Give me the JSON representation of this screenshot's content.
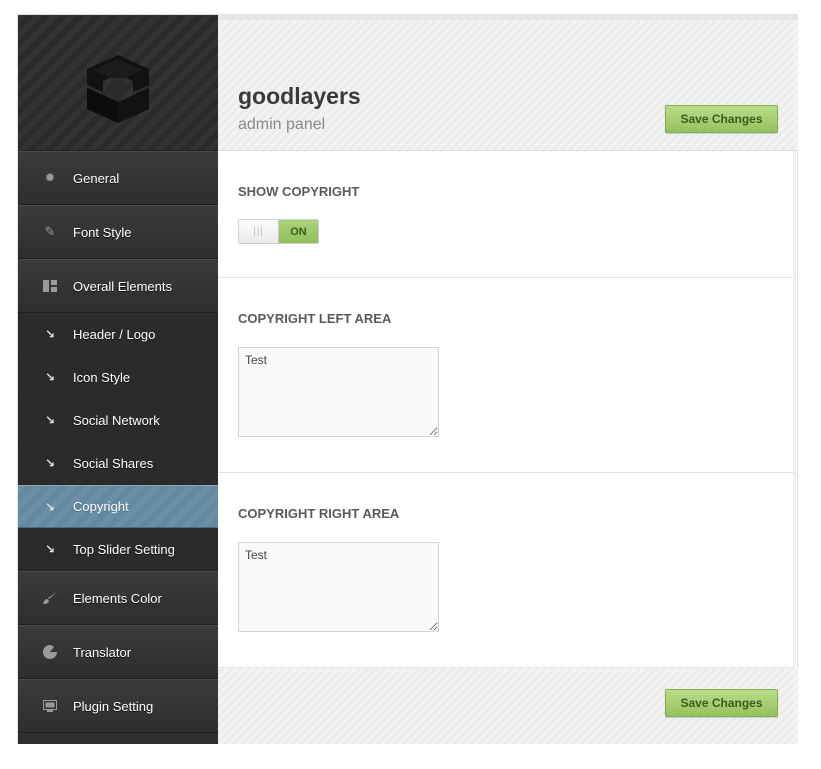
{
  "brand": {
    "title": "goodlayers",
    "subtitle": "admin panel"
  },
  "actions": {
    "save_label": "Save Changes"
  },
  "sidebar": {
    "items": [
      {
        "label": "General",
        "icon": "gear-icon",
        "type": "main"
      },
      {
        "label": "Font Style",
        "icon": "pencil-icon",
        "type": "main"
      },
      {
        "label": "Overall Elements",
        "icon": "layout-icon",
        "type": "main"
      },
      {
        "label": "Header / Logo",
        "icon": "arrow-down-right-icon",
        "type": "sub"
      },
      {
        "label": "Icon Style",
        "icon": "arrow-down-right-icon",
        "type": "sub"
      },
      {
        "label": "Social Network",
        "icon": "arrow-down-right-icon",
        "type": "sub"
      },
      {
        "label": "Social Shares",
        "icon": "arrow-down-right-icon",
        "type": "sub"
      },
      {
        "label": "Copyright",
        "icon": "arrow-down-right-icon",
        "type": "sub",
        "active": true
      },
      {
        "label": "Top Slider Setting",
        "icon": "arrow-down-right-icon",
        "type": "sub"
      },
      {
        "label": "Elements Color",
        "icon": "brush-icon",
        "type": "main"
      },
      {
        "label": "Translator",
        "icon": "translator-icon",
        "type": "main"
      },
      {
        "label": "Plugin Setting",
        "icon": "plugin-icon",
        "type": "main"
      }
    ]
  },
  "sections": {
    "show_copyright": {
      "title": "SHOW COPYRIGHT",
      "toggle_state": "ON",
      "toggle_grip": "|||"
    },
    "copyright_left": {
      "title": "COPYRIGHT LEFT AREA",
      "value": "Test"
    },
    "copyright_right": {
      "title": "COPYRIGHT RIGHT AREA",
      "value": "Test"
    }
  },
  "colors": {
    "sidebar_bg": "#2f2f2f",
    "active_item": "#6c8fa6",
    "accent_green": "#95c35f",
    "title_text": "#3a3a3a"
  }
}
